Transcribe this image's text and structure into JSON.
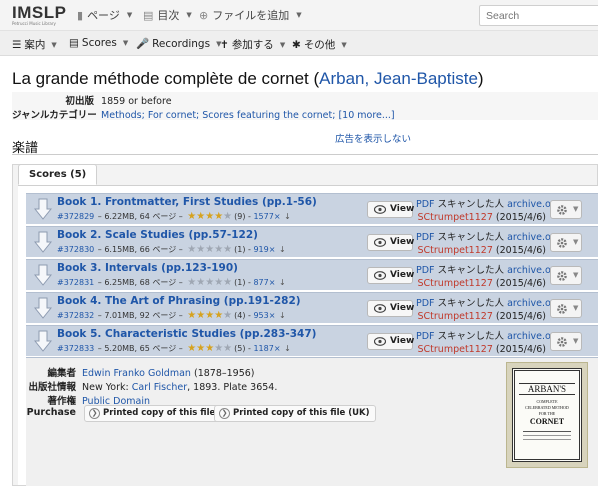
{
  "header": {
    "logo": "IMSLP",
    "logo_sub": "Petrucci Music Library",
    "nav": [
      {
        "label": "ページ",
        "icon": "page-icon"
      },
      {
        "label": "目次",
        "icon": "toc-icon"
      },
      {
        "label": "ファイルを追加",
        "icon": "add-circle-icon"
      }
    ],
    "search_placeholder": "Search"
  },
  "subnav": [
    {
      "label": "案内",
      "icon": "hamburger-icon"
    },
    {
      "label": "Scores",
      "icon": "book-icon"
    },
    {
      "label": "Recordings",
      "icon": "microphone-icon"
    },
    {
      "label": "参加する",
      "icon": "person-icon"
    },
    {
      "label": "その他",
      "icon": "asterisk-icon"
    }
  ],
  "title": {
    "prefix": "La grande méthode complète de cornet (",
    "composer": "Arban, Jean-Baptiste",
    "suffix": ")"
  },
  "info": {
    "first_pub_key": "初出版",
    "first_pub_value": "1859 or before",
    "genre_key": "ジャンルカテゴリー",
    "genres": "Methods; For cornet; Scores featuring the cornet;",
    "more": "[10 more...]"
  },
  "section_title": "楽譜",
  "hide_ads": "広告を表示しない",
  "tab_label": "Scores (5)",
  "files": [
    {
      "title": "Book 1. Frontmatter, First Studies (pp.1-56)",
      "id": "#372829",
      "size": "6.22MB",
      "pages": "64 ページ",
      "rating": 3.5,
      "votes": "(9)",
      "downloads": "1577×",
      "view": "View",
      "src_pdf": "PDF",
      "src_text": "スキャンした人",
      "src_site": "archive.org",
      "uploader": "SCtrumpet1127",
      "date": "(2015/4/6)"
    },
    {
      "title": "Book 2. Scale Studies (pp.57-122)",
      "id": "#372830",
      "size": "6.15MB",
      "pages": "66 ページ",
      "rating": 0,
      "votes": "(1)",
      "downloads": "919×",
      "view": "View",
      "src_pdf": "PDF",
      "src_text": "スキャンした人",
      "src_site": "archive.org",
      "uploader": "SCtrumpet1127",
      "date": "(2015/4/6)"
    },
    {
      "title": "Book 3. Intervals (pp.123-190)",
      "id": "#372831",
      "size": "6.25MB",
      "pages": "68 ページ",
      "rating": 0,
      "votes": "(1)",
      "downloads": "877×",
      "view": "View",
      "src_pdf": "PDF",
      "src_text": "スキャンした人",
      "src_site": "archive.org",
      "uploader": "SCtrumpet1127",
      "date": "(2015/4/6)"
    },
    {
      "title": "Book 4. The Art of Phrasing (pp.191-282)",
      "id": "#372832",
      "size": "7.01MB",
      "pages": "92 ページ",
      "rating": 3.5,
      "votes": "(4)",
      "downloads": "953×",
      "view": "View",
      "src_pdf": "PDF",
      "src_text": "スキャンした人",
      "src_site": "archive.org",
      "uploader": "SCtrumpet1127",
      "date": "(2015/4/6)"
    },
    {
      "title": "Book 5. Characteristic Studies (pp.283-347)",
      "id": "#372833",
      "size": "5.20MB",
      "pages": "65 ページ",
      "rating": 2.5,
      "votes": "(5)",
      "downloads": "1187×",
      "view": "View",
      "src_pdf": "PDF",
      "src_text": "スキャンした人",
      "src_site": "archive.org",
      "uploader": "SCtrumpet1127",
      "date": "(2015/4/6)"
    }
  ],
  "meta": {
    "editor_key": "編集者",
    "editor": "Edwin Franko Goldman",
    "editor_years": "(1878–1956)",
    "publisher_key": "出版社情報",
    "publisher_pre": "New York: ",
    "publisher_link": "Carl Fischer",
    "publisher_post": ", 1893. Plate 3654.",
    "copyright_key": "著作権",
    "copyright": "Public Domain",
    "purchase_key": "Purchase",
    "buy_us": "Printed copy of this file (US)",
    "buy_uk": "Printed copy of this file (UK)"
  },
  "thumbnail": {
    "line1": "ARBAN'S",
    "line2": "COMPLETE",
    "line3": "CELEBRATED METHOD",
    "line4": "FOR THE",
    "line5": "CORNET"
  },
  "colors": {
    "link": "#1f56a8",
    "row_bg": "#c9d3e1",
    "uploader": "#c0392b",
    "star": "#d6a21e"
  }
}
